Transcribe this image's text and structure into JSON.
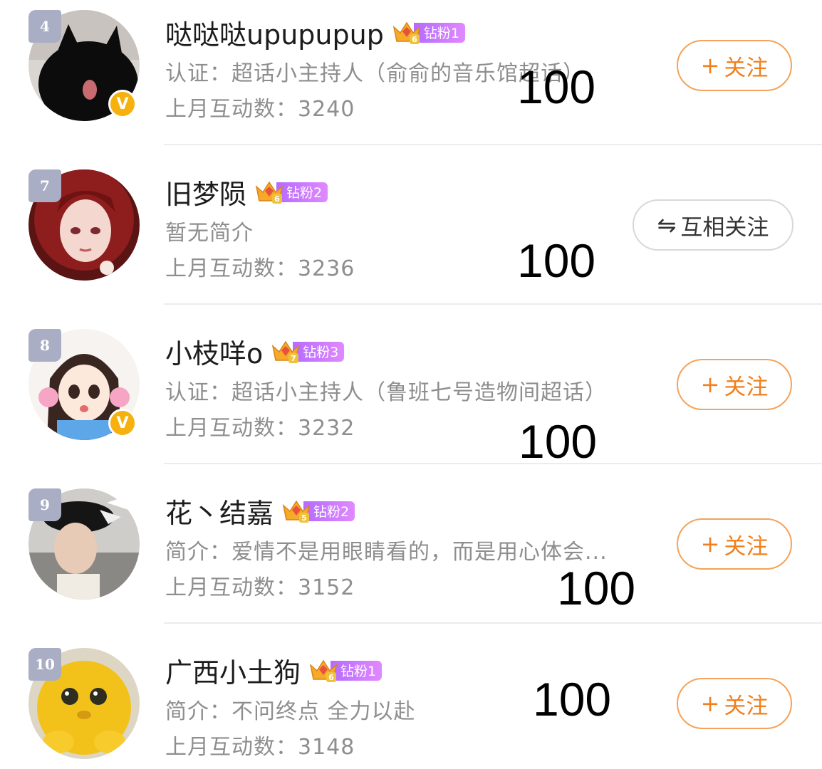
{
  "users": [
    {
      "rank": "4",
      "name": "哒哒哒upupupup",
      "crown_level": "6",
      "fan_label": "钻粉1",
      "desc": "认证：超话小主持人（俞俞的音乐馆超话）",
      "interact_label": "上月互动数：",
      "interact_value": "3240",
      "score": "100",
      "verified": true,
      "button_label": "关注",
      "button_type": "follow",
      "avatar": "black-cat"
    },
    {
      "rank": "7",
      "name": "旧梦陨",
      "crown_level": "6",
      "fan_label": "钻粉2",
      "desc": "暂无简介",
      "interact_label": "上月互动数：",
      "interact_value": "3236",
      "score": "100",
      "verified": false,
      "button_label": "互相关注",
      "button_type": "mutual",
      "avatar": "red-hair-girl"
    },
    {
      "rank": "8",
      "name": "小枝咩o",
      "crown_level": "7",
      "fan_label": "钻粉3",
      "desc": "认证：超话小主持人（鲁班七号造物间超话）",
      "interact_label": "上月互动数：",
      "interact_value": "3232",
      "score": "100",
      "verified": true,
      "button_label": "关注",
      "button_type": "follow",
      "avatar": "anime-girl-headphones"
    },
    {
      "rank": "9",
      "name": "花丶结嘉",
      "crown_level": "5",
      "fan_label": "钻粉2",
      "desc": "简介：爱情不是用眼睛看的，而是用心体会...",
      "interact_label": "上月互动数：",
      "interact_value": "3152",
      "score": "100",
      "verified": false,
      "button_label": "关注",
      "button_type": "follow",
      "avatar": "person-beret-bird"
    },
    {
      "rank": "10",
      "name": "广西小土狗",
      "crown_level": "6",
      "fan_label": "钻粉1",
      "desc": "简介：不问终点 全力以赴",
      "interact_label": "上月互动数：",
      "interact_value": "3148",
      "score": "100",
      "verified": false,
      "button_label": "关注",
      "button_type": "follow",
      "avatar": "yellow-creature"
    }
  ],
  "colors": {
    "follow_border": "#f3a35b",
    "follow_text": "#f07f1d",
    "rank_badge": "#a9aec4",
    "fan_badge": "#b56bff",
    "verified_badge": "#f6b10f"
  },
  "icons": {
    "follow": "plus-icon",
    "mutual": "swap-arrows-icon",
    "crown": "crown-icon",
    "verified": "verified-v-icon"
  }
}
